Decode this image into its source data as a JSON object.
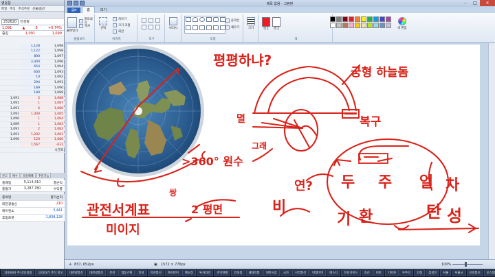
{
  "trading_app": {
    "title": "영웅문",
    "menu": [
      "파일",
      "주식",
      "주식주문",
      "선물/옵션",
      "선물"
    ],
    "symbol_code": "252620",
    "symbol_name": "인성정",
    "quote": {
      "price": "1,091",
      "dir": "▲",
      "change": "8",
      "rate": "+0.74%"
    },
    "header_labels": [
      "증감",
      "",
      "1,091",
      "1,099"
    ],
    "orderbook": [
      {
        "side": "sell",
        "a": "",
        "b": "1,128",
        "c": "1,098"
      },
      {
        "side": "sell",
        "a": "",
        "b": "1,122",
        "c": "1,098"
      },
      {
        "side": "sell",
        "a": "",
        "b": "800",
        "c": "1,097"
      },
      {
        "side": "sell",
        "a": "",
        "b": "3,400",
        "c": "1,096"
      },
      {
        "side": "sell",
        "a": "",
        "b": "654",
        "c": "1,094"
      },
      {
        "side": "sell",
        "a": "",
        "b": "600",
        "c": "1,093"
      },
      {
        "side": "sell",
        "a": "",
        "b": "10",
        "c": "1,092"
      },
      {
        "side": "sell",
        "a": "",
        "b": "294",
        "c": "1,091"
      },
      {
        "side": "sell",
        "a": "",
        "b": "189",
        "c": "1,090"
      },
      {
        "side": "sell",
        "a": "",
        "b": "189",
        "c": "1,089"
      },
      {
        "side": "buy",
        "a": "1,091",
        "b": "5",
        "c": "1,088"
      },
      {
        "side": "buy",
        "a": "1,091",
        "b": "1",
        "c": "1,087"
      },
      {
        "side": "buy",
        "a": "1,091",
        "b": "6",
        "c": "1,086"
      },
      {
        "side": "buy",
        "a": "1,091",
        "b": "1,300",
        "c": "1,085"
      },
      {
        "side": "buy",
        "a": "1,090",
        "b": "1",
        "c": "1,084"
      },
      {
        "side": "buy",
        "a": "1,089",
        "b": "1",
        "c": "1,083"
      },
      {
        "side": "buy",
        "a": "1,091",
        "b": "2",
        "c": "1,082"
      },
      {
        "side": "buy",
        "a": "1,091",
        "b": "1,202",
        "c": "1,081"
      },
      {
        "side": "buy",
        "a": "1,090",
        "b": "120",
        "c": "1,080"
      },
      {
        "side": "buy",
        "a": "",
        "b": "1,567",
        "c": "-631"
      }
    ],
    "orderbook_footer": "시간외",
    "tabs": [
      "잔고",
      "매수",
      "당일매매",
      "주문가능",
      "주문"
    ],
    "summary": [
      {
        "label": "총매입",
        "value": "5,114,410",
        "extra": "총손익"
      },
      {
        "label": "총평가",
        "value": "3,287,780",
        "extra": "수익률"
      }
    ],
    "holdings_header": {
      "name": "종목명",
      "pl": "평가손익"
    },
    "holdings": [
      {
        "name": "대한광통신",
        "pl": "210",
        "sign": "pos"
      },
      {
        "name": "에이앤소",
        "pl": "3,441",
        "sign": "neg"
      },
      {
        "name": "휴림로봇",
        "pl": "-1,838,128",
        "sign": "neg"
      }
    ]
  },
  "paint": {
    "window_title": "제목 없음 - 그림판",
    "file_tab": "",
    "tabs": [
      "홈",
      "보기"
    ],
    "groups": {
      "clipboard": {
        "label": "클립보드",
        "paste": "붙여넣기",
        "cut": "잘라내기",
        "copy": "복사"
      },
      "image": {
        "label": "이미지",
        "select": "선택",
        "crop": "자르기",
        "resize": "크기 조정",
        "rotate": "회전"
      },
      "tools": {
        "label": "도구"
      },
      "brush": {
        "label": "브러시"
      },
      "shapes": {
        "label": "도형",
        "outline": "윤곽선",
        "fill": "채우기"
      },
      "size": {
        "label": "크기"
      },
      "colors": {
        "label": "색",
        "color1": "색 1",
        "color2": "색 2",
        "edit": "색 편집"
      }
    },
    "palette": [
      "#000000",
      "#7f7f7f",
      "#880015",
      "#ed1c24",
      "#ff7f27",
      "#fff200",
      "#22b14c",
      "#00a2e8",
      "#3f48cc",
      "#a349a4",
      "#ffffff",
      "#c3c3c3",
      "#b97a57",
      "#ffaec9",
      "#ffc90e",
      "#efe4b0",
      "#b5e61d",
      "#99d9ea",
      "#7092be",
      "#c8bfe7"
    ],
    "status": {
      "cursor": "837, 652px",
      "size": "1572 × 776px",
      "zoom": "100%"
    }
  },
  "annotations": {
    "flat": "평평하냐?",
    "dome": "궁형 하늘돔",
    "myeol": "멸",
    "bokgu": "복구",
    "angle": "그래",
    "deg": ">360° 원수",
    "bi": "비",
    "yeon": "연?",
    "du": "두",
    "ju": "주",
    "eol": "얼",
    "cha": "차",
    "tan": "탄",
    "seong": "성",
    "gi": "기",
    "hwan": "환",
    "ssang": "쌍",
    "gwan": "관전서계표",
    "twomyeon": "2 평면",
    "miji": "미이지"
  },
  "taskbar": [
    "1[0000] 주식/인성정",
    "1[0037] 주식 잔고",
    "대한광통신",
    "대한광통신",
    "유진",
    "협동기획",
    "인성",
    "유진통신",
    "하이바이",
    "메모장",
    "투자의견",
    "손익현황",
    "인성정",
    "세대유통",
    "대한시장",
    "시가",
    "신라통신",
    "미래바이",
    "에스디",
    "유진가이드",
    "조선",
    "비아",
    "기아차",
    "우주선",
    "인성",
    "삼성전",
    "서울",
    "서울시",
    "신성통신",
    "오스템"
  ]
}
